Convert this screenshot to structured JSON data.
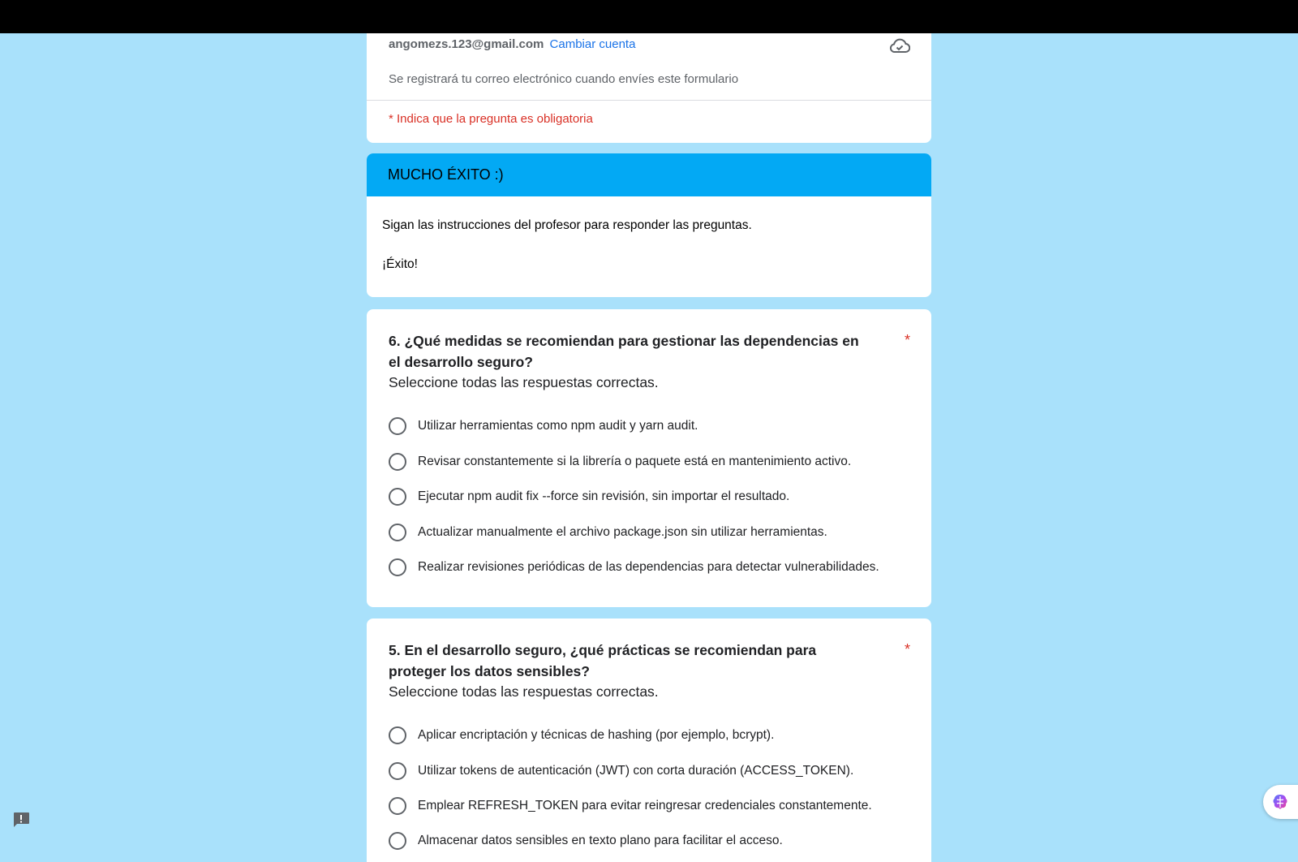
{
  "header": {
    "email": "angomezs.123@gmail.com",
    "switch_account": "Cambiar cuenta",
    "record_note": "Se registrará tu correo electrónico cuando envíes este formulario",
    "required_note": "* Indica que la pregunta es obligatoria",
    "cloud_icon": "cloud-check-icon"
  },
  "section": {
    "title": "MUCHO ÉXITO :)",
    "description_line1": "Sigan las instrucciones del profesor para responder las preguntas.",
    "description_line2": "¡Éxito!",
    "header_color": "#03a9f4"
  },
  "questions": [
    {
      "title": "6. ¿Qué medidas se recomiendan para gestionar las dependencias en el desarrollo seguro?",
      "required_mark": "*",
      "subtitle": "Seleccione todas las respuestas correctas.",
      "options": [
        "Utilizar herramientas como npm audit y yarn audit.",
        "Revisar constantemente si la librería o paquete está en mantenimiento activo.",
        "Ejecutar npm audit fix --force sin revisión, sin importar el resultado.",
        "Actualizar manualmente el archivo package.json sin utilizar herramientas.",
        "Realizar revisiones periódicas de las dependencias para detectar vulnerabilidades."
      ]
    },
    {
      "title": "5. En el desarrollo seguro, ¿qué prácticas se recomiendan para proteger los datos sensibles?",
      "required_mark": "*",
      "subtitle": "Seleccione todas las respuestas correctas.",
      "options": [
        "Aplicar encriptación y técnicas de hashing (por ejemplo, bcrypt).",
        "Utilizar tokens de autenticación (JWT) con corta duración (ACCESS_TOKEN).",
        "Emplear REFRESH_TOKEN para evitar reingresar credenciales constantemente.",
        "Almacenar datos sensibles en texto plano para facilitar el acceso."
      ]
    }
  ],
  "colors": {
    "background": "#a9e1fb",
    "accent": "#03a9f4",
    "required": "#d93025",
    "link": "#1a73e8"
  },
  "floating": {
    "feedback_icon": "report-feedback-icon",
    "widget_icon": "brain-icon"
  }
}
